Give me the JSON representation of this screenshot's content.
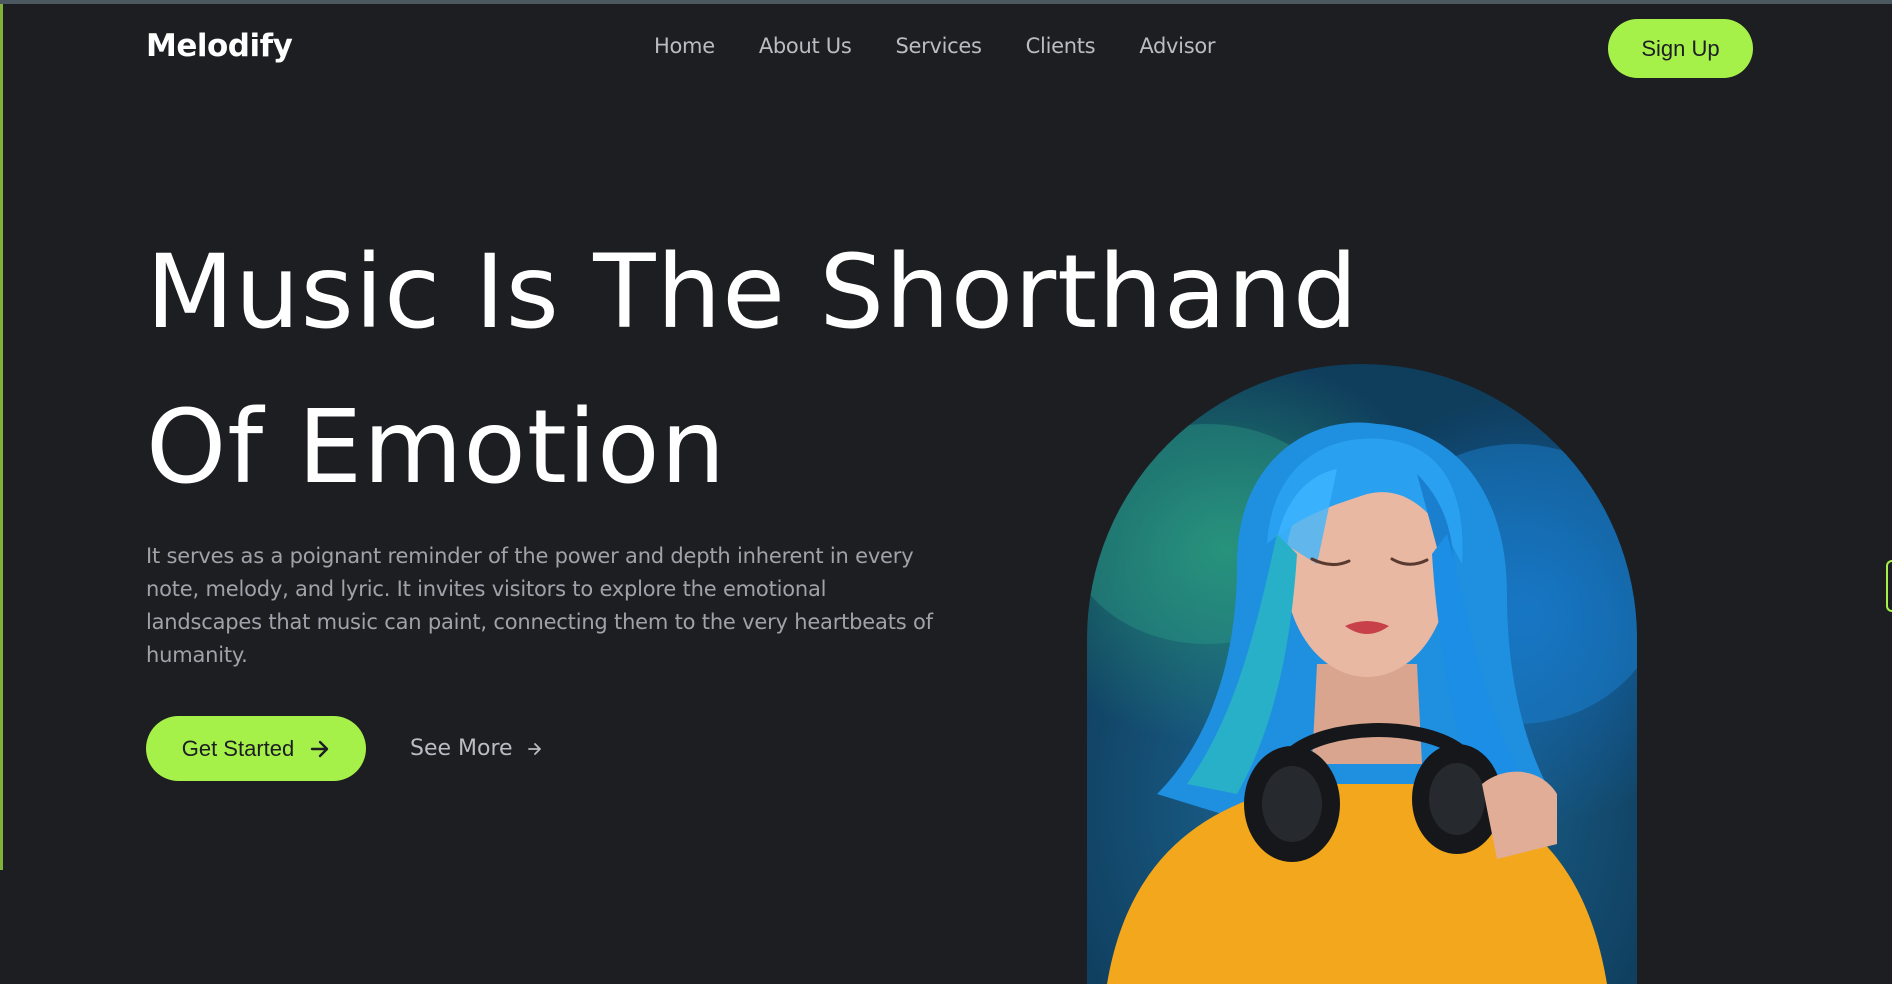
{
  "brand": {
    "name": "Melodify"
  },
  "nav": {
    "items": [
      {
        "label": "Home"
      },
      {
        "label": "About Us"
      },
      {
        "label": "Services"
      },
      {
        "label": "Clients"
      },
      {
        "label": "Advisor"
      }
    ],
    "signup_label": "Sign Up"
  },
  "hero": {
    "title_line1": "Music Is The Shorthand",
    "title_line2": "Of Emotion",
    "description": "It serves as a poignant reminder of the power and depth inherent in every note, melody, and lyric. It invites visitors to explore the emotional landscapes that music can paint, connecting them to the very heartbeats of humanity.",
    "primary_cta": "Get Started",
    "secondary_cta": "See More",
    "image_icon": "woman-with-headphones-photo"
  },
  "colors": {
    "background": "#1c1e22",
    "accent": "#a6f04a",
    "text_primary": "#ffffff",
    "text_muted": "#9fa3a9"
  }
}
